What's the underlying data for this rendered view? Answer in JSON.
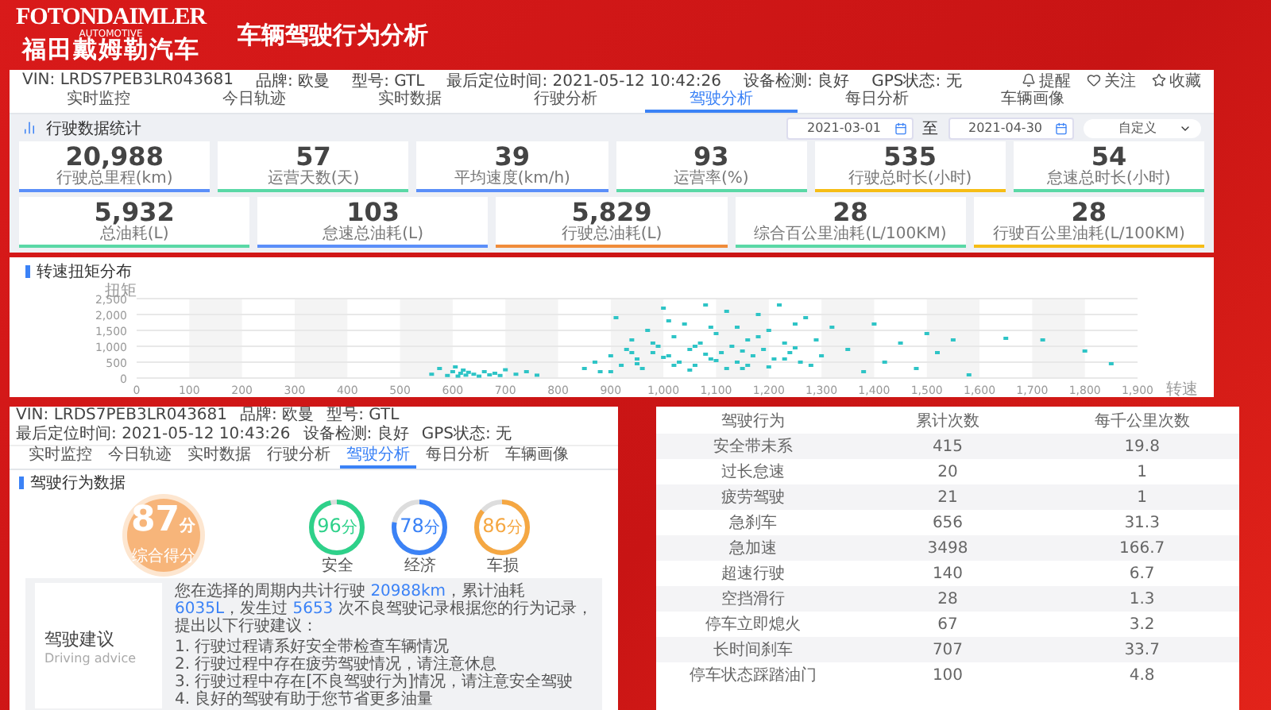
{
  "header": {
    "logo_brand": "FOTONDAIMLER",
    "logo_sub": "AUTOMOTIVE",
    "logo_cn": "福田戴姆勒汽车",
    "title": "车辆驾驶行为分析"
  },
  "main_panel": {
    "info": [
      {
        "label": "VIN:",
        "value": "LRDS7PEB3LR043681"
      },
      {
        "label": "品牌:",
        "value": "欧曼"
      },
      {
        "label": "型号:",
        "value": "GTL"
      },
      {
        "label": "最后定位时间:",
        "value": "2021-05-12 10:42:26"
      },
      {
        "label": "设备检测:",
        "value": "良好"
      },
      {
        "label": "GPS状态:",
        "value": "无"
      }
    ],
    "actions": [
      {
        "kind": "bell",
        "label": "提醒"
      },
      {
        "kind": "heart",
        "label": "关注"
      },
      {
        "kind": "star",
        "label": "收藏"
      }
    ],
    "tabs": [
      {
        "label": "实时监控",
        "selected": false
      },
      {
        "label": "今日轨迹",
        "selected": false
      },
      {
        "label": "实时数据",
        "selected": false
      },
      {
        "label": "行驶分析",
        "selected": false
      },
      {
        "label": "驾驶分析",
        "selected": true
      },
      {
        "label": "每日分析",
        "selected": false
      },
      {
        "label": "车辆画像",
        "selected": false
      }
    ],
    "stats": {
      "title": "行驶数据统计",
      "date_from": "2021-03-01",
      "separator": "至",
      "date_to": "2021-04-30",
      "range_select": "自定义",
      "cards_top": [
        {
          "value": "20,988",
          "label": "行驶总里程(km)",
          "color": "#5b8ff9"
        },
        {
          "value": "57",
          "label": "运营天数(天)",
          "color": "#5ad8a6"
        },
        {
          "value": "39",
          "label": "平均速度(km/h)",
          "color": "#5b8ff9"
        },
        {
          "value": "93",
          "label": "运营率(%)",
          "color": "#5ad8a6"
        },
        {
          "value": "535",
          "label": "行驶总时长(小时)",
          "color": "#f6bd16"
        },
        {
          "value": "54",
          "label": "怠速总时长(小时)",
          "color": "#5ad8a6"
        }
      ],
      "cards_bottom": [
        {
          "value": "5,932",
          "label": "总油耗(L)",
          "color": "#5ad8a6"
        },
        {
          "value": "103",
          "label": "怠速总油耗(L)",
          "color": "#5b8ff9"
        },
        {
          "value": "5,829",
          "label": "行驶总油耗(L)",
          "color": "#f08c3a"
        },
        {
          "value": "28",
          "label": "综合百公里油耗(L/100KM)",
          "color": "#5ad8a6"
        },
        {
          "value": "28",
          "label": "行驶百公里油耗(L/100KM)",
          "color": "#f6bd16"
        }
      ]
    }
  },
  "chart_panel": {
    "title": "转速扭矩分布",
    "chart_data": {
      "type": "scatter",
      "grid": true,
      "xlabel": "转速",
      "ylabel": "扭矩",
      "xlim": [
        0,
        1900
      ],
      "ylim": [
        0,
        2500
      ],
      "xticks": [
        0,
        100,
        200,
        300,
        400,
        500,
        600,
        700,
        800,
        900,
        {
          "value": 1000,
          "label": "1,000"
        },
        {
          "value": 1100,
          "label": "1,100"
        },
        {
          "value": 1200,
          "label": "1,200"
        },
        {
          "value": 1300,
          "label": "1,300"
        },
        {
          "value": 1400,
          "label": "1,400"
        },
        {
          "value": 1500,
          "label": "1,500"
        },
        {
          "value": 1600,
          "label": "1,600"
        },
        {
          "value": 1700,
          "label": "1,700"
        },
        {
          "value": 1800,
          "label": "1,800"
        },
        {
          "value": 1900,
          "label": "1,900"
        }
      ],
      "yticks": [
        0,
        500,
        {
          "value": 1000,
          "label": "1,000"
        },
        {
          "value": 1500,
          "label": "1,500"
        },
        {
          "value": 2000,
          "label": "2,000"
        },
        {
          "value": 2500,
          "label": "2,500"
        }
      ],
      "x": [
        560,
        575,
        590,
        600,
        605,
        610,
        615,
        620,
        625,
        630,
        640,
        650,
        660,
        670,
        680,
        690,
        700,
        720,
        740,
        760,
        850,
        870,
        880,
        900,
        910,
        920,
        930,
        940,
        950,
        960,
        970,
        980,
        990,
        1000,
        1010,
        1020,
        1030,
        1040,
        1050,
        1060,
        1070,
        1080,
        1090,
        1100,
        1110,
        1120,
        1130,
        1140,
        1150,
        1160,
        1170,
        1180,
        1190,
        1200,
        1210,
        1220,
        1230,
        1240,
        1250,
        1260,
        1270,
        1280,
        1290,
        1300,
        900,
        950,
        1000,
        1050,
        1100,
        1150,
        1200,
        1250,
        980,
        1020,
        1080,
        1140,
        1180,
        1060,
        1120,
        940,
        1010,
        1090,
        1160,
        1230,
        1320,
        1350,
        1380,
        1400,
        1420,
        1450,
        1480,
        1500,
        1520,
        1550,
        1580,
        1650,
        1720,
        1800,
        1850
      ],
      "series": [
        {
          "color": "#2ec4c6",
          "values": [
            120,
            300,
            80,
            200,
            350,
            60,
            150,
            250,
            90,
            180,
            120,
            60,
            200,
            100,
            150,
            80,
            260,
            120,
            200,
            90,
            300,
            500,
            200,
            700,
            1900,
            400,
            900,
            1200,
            600,
            300,
            1500,
            800,
            1000,
            2200,
            700,
            1300,
            500,
            1700,
            900,
            400,
            1100,
            2300,
            600,
            1400,
            800,
            2100,
            1000,
            1600,
            300,
            1200,
            700,
            2000,
            900,
            1500,
            600,
            2300,
            1100,
            800,
            1700,
            500,
            1900,
            400,
            1200,
            700,
            200,
            450,
            650,
            250,
            550,
            850,
            350,
            950,
            1100,
            400,
            750,
            500,
            1300,
            1000,
            300,
            800,
            1800,
            1600,
            400,
            600,
            1600,
            900,
            200,
            1700,
            500,
            1100,
            300,
            1400,
            800,
            1200,
            100,
            1250,
            1200,
            850,
            450
          ]
        }
      ]
    }
  },
  "behavior_panel": {
    "info": [
      {
        "label": "VIN:",
        "value": "LRDS7PEB3LR043681"
      },
      {
        "label": "品牌:",
        "value": "欧曼"
      },
      {
        "label": "型号:",
        "value": "GTL"
      },
      {
        "label": "最后定位时间:",
        "value": "2021-05-12 10:43:26"
      },
      {
        "label": "设备检测:",
        "value": "良好"
      },
      {
        "label": "GPS状态:",
        "value": "无"
      }
    ],
    "tabs": [
      {
        "label": "实时监控",
        "selected": false
      },
      {
        "label": "今日轨迹",
        "selected": false
      },
      {
        "label": "实时数据",
        "selected": false
      },
      {
        "label": "行驶分析",
        "selected": false
      },
      {
        "label": "驾驶分析",
        "selected": true
      },
      {
        "label": "每日分析",
        "selected": false
      },
      {
        "label": "车辆画像",
        "selected": false
      }
    ],
    "section_title": "驾驶行为数据",
    "overall": {
      "score": "87",
      "unit": "分",
      "label": "综合得分"
    },
    "scores": [
      {
        "score": "96",
        "unit": "分",
        "label": "安全",
        "level": 0.96,
        "color": "#2ed18a"
      },
      {
        "score": "78",
        "unit": "分",
        "label": "经济",
        "level": 0.78,
        "color": "#3b82f6"
      },
      {
        "score": "86",
        "unit": "分",
        "label": "车损",
        "level": 0.86,
        "color": "#f5a742"
      }
    ],
    "advice": {
      "title": "驾驶建议",
      "subtitle": "Driving advice",
      "summary": [
        {
          "text": "您在选择的周期内共计行驶 ",
          "highlight": false
        },
        {
          "text": "20988km",
          "highlight": true
        },
        {
          "text": "，累计油耗 ",
          "highlight": false
        },
        {
          "text": "6035L",
          "highlight": true
        },
        {
          "text": "，发生过 ",
          "highlight": false
        },
        {
          "text": "5653",
          "highlight": true
        },
        {
          "text": " 次不良驾驶记录根据您的行为记录，提出以下行驶建议：",
          "highlight": false
        }
      ],
      "items": [
        "1. 行驶过程请系好安全带检查车辆情况",
        "2. 行驶过程中存在疲劳驾驶情况，请注意休息",
        "3. 行驶过程中存在[不良驾驶行为]情况，请注意安全驾驶",
        "4. 良好的驾驶有助于您节省更多油量"
      ]
    }
  },
  "behavior_table": {
    "columns": [
      "驾驶行为",
      "累计次数",
      "每千公里次数"
    ],
    "rows": [
      [
        "安全带未系",
        "415",
        "19.8"
      ],
      [
        "过长怠速",
        "20",
        "1"
      ],
      [
        "疲劳驾驶",
        "21",
        "1"
      ],
      [
        "急刹车",
        "656",
        "31.3"
      ],
      [
        "急加速",
        "3498",
        "166.7"
      ],
      [
        "超速行驶",
        "140",
        "6.7"
      ],
      [
        "空挡滑行",
        "28",
        "1.3"
      ],
      [
        "停车立即熄火",
        "67",
        "3.2"
      ],
      [
        "长时间刹车",
        "707",
        "33.7"
      ],
      [
        "停车状态踩踏油门",
        "100",
        "4.8"
      ]
    ]
  }
}
